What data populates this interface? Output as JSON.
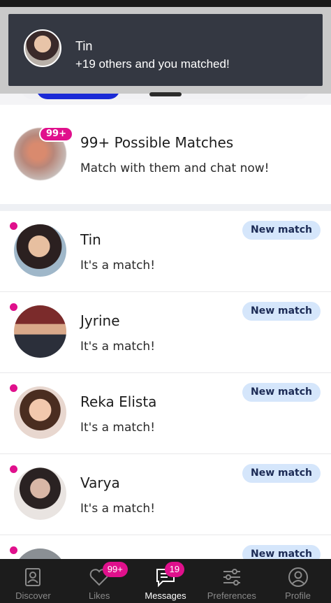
{
  "notification": {
    "title": "Tin",
    "subtitle": "+19 others and you matched!"
  },
  "possible_matches": {
    "badge": "99+",
    "title": "99+ Possible Matches",
    "subtitle": "Match with them and chat now!"
  },
  "matches": [
    {
      "name": "Tin",
      "message": "It's a match!",
      "tag": "New match"
    },
    {
      "name": "Jyrine",
      "message": "It's a match!",
      "tag": "New match"
    },
    {
      "name": "Reka Elista",
      "message": "It's a match!",
      "tag": "New match"
    },
    {
      "name": "Varya",
      "message": "It's a match!",
      "tag": "New match"
    },
    {
      "name": "",
      "message": "",
      "tag": "New match"
    }
  ],
  "nav": {
    "discover": "Discover",
    "likes": "Likes",
    "likes_badge": "99+",
    "messages": "Messages",
    "messages_badge": "19",
    "preferences": "Preferences",
    "profile": "Profile"
  },
  "colors": {
    "accent_pink": "#e0108c",
    "tag_bg": "#d5e6fb",
    "nav_bg": "#1c1c1c",
    "segment_active": "#1a2ad6"
  }
}
